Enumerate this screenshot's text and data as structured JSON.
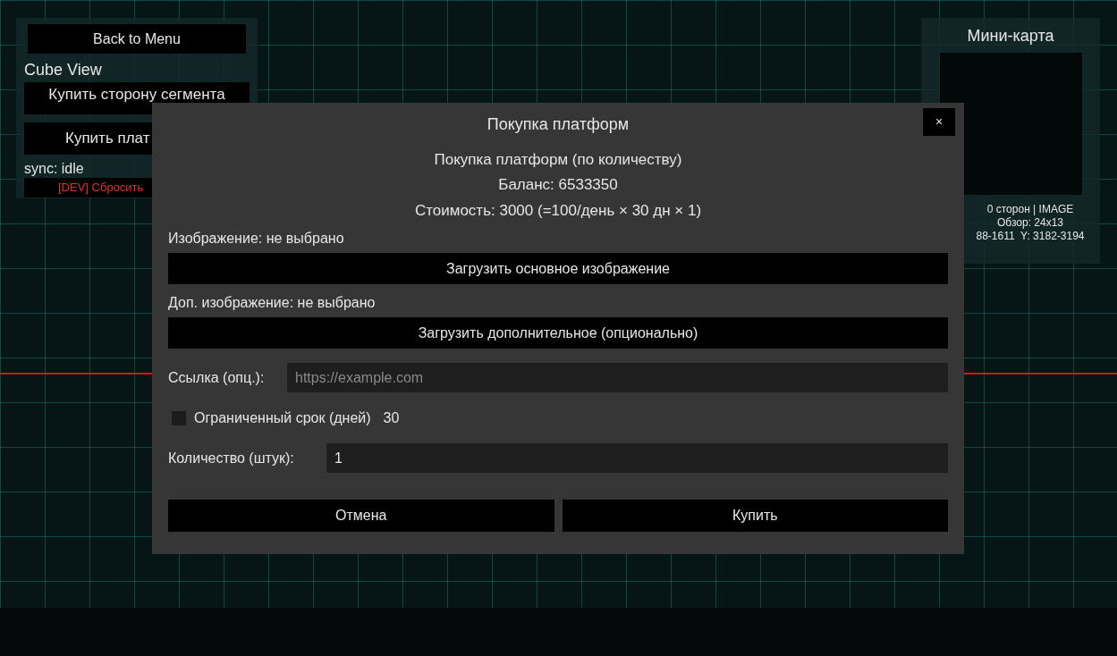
{
  "hud": {
    "back_button": "Back to Menu",
    "view_title": "Cube View",
    "buttons": [
      "Купить сторону сегмента",
      "Купить плат"
    ],
    "sync_status": "sync: idle",
    "dev_button": "[DEV] Сбросить"
  },
  "minimap": {
    "title": "Мини-карта",
    "info": [
      "0 сторон | IMAGE",
      "Обзор: 24x13",
      "88-1611  Y: 3182-3194"
    ]
  },
  "dialog": {
    "title": "Покупка платформ",
    "close": "×",
    "subtitle": "Покупка платформ (по количеству)",
    "balance": "Баланс: 6533350",
    "cost": "Стоимость: 3000 (=100/день × 30 дн × 1)",
    "main_image": {
      "label": "Изображение: не выбрано",
      "button": "Загрузить основное изображение"
    },
    "extra_image": {
      "label": "Доп. изображение: не выбрано",
      "button": "Загрузить дополнительное (опционально)"
    },
    "link": {
      "label": "Ссылка (опц.):",
      "placeholder": "https://example.com"
    },
    "limited": {
      "label": "Ограниченный срок (дней)",
      "checked": false,
      "days": "30"
    },
    "quantity": {
      "label": "Количество (штук):",
      "value": "1"
    },
    "buttons": [
      "Отмена",
      "Купить"
    ]
  }
}
